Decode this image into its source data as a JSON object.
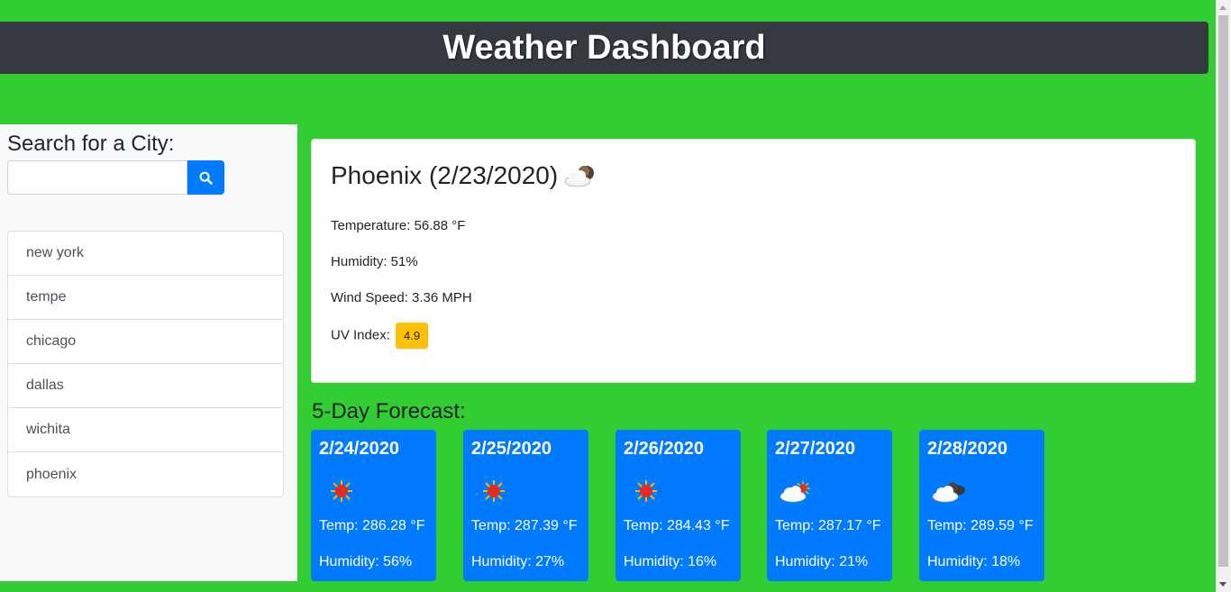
{
  "header": {
    "title": "Weather Dashboard"
  },
  "sidebar": {
    "heading": "Search for a City:",
    "search": {
      "value": "",
      "placeholder": ""
    },
    "search_button_icon": "search-icon",
    "cities": [
      "new york",
      "tempe",
      "chicago",
      "dallas",
      "wichita",
      "phoenix"
    ]
  },
  "current": {
    "title": "Phoenix (2/23/2020)",
    "icon": "cloud-night-icon",
    "temperature": "Temperature: 56.88 °F",
    "humidity": "Humidity: 51%",
    "wind": "Wind Speed: 3.36 MPH",
    "uv_label": "UV Index:",
    "uv_value": "4.9",
    "uv_color": "#ffc107"
  },
  "forecast": {
    "heading": "5-Day Forecast:",
    "days": [
      {
        "date": "2/24/2020",
        "icon": "sun-icon",
        "temp": "Temp: 286.28 °F",
        "humidity": "Humidity: 56%"
      },
      {
        "date": "2/25/2020",
        "icon": "sun-icon",
        "temp": "Temp: 287.39 °F",
        "humidity": "Humidity: 27%"
      },
      {
        "date": "2/26/2020",
        "icon": "sun-icon",
        "temp": "Temp: 284.43 °F",
        "humidity": "Humidity: 16%"
      },
      {
        "date": "2/27/2020",
        "icon": "partly-cloudy-icon",
        "temp": "Temp: 287.17 °F",
        "humidity": "Humidity: 21%"
      },
      {
        "date": "2/28/2020",
        "icon": "cloudy-night-icon",
        "temp": "Temp: 289.59 °F",
        "humidity": "Humidity: 18%"
      }
    ]
  },
  "colors": {
    "background": "#32cd32",
    "header": "#343a40",
    "accent": "#007bff"
  }
}
